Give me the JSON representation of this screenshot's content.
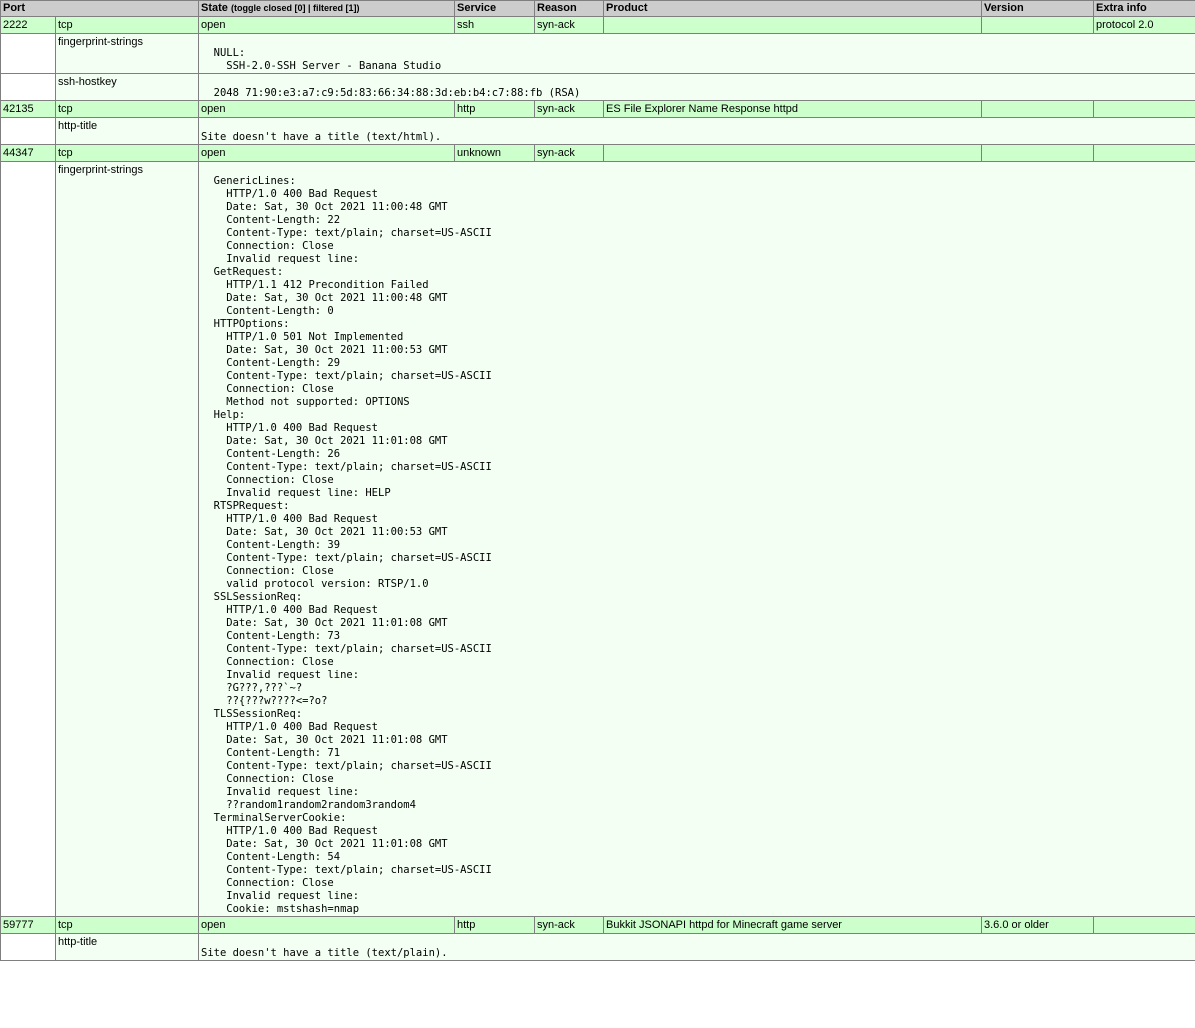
{
  "header": {
    "port": "Port",
    "state": "State",
    "state_hint_open": "(",
    "toggle_closed": "toggle closed [0]",
    "hint_sep": " | ",
    "filtered": "filtered [1]",
    "state_hint_close": ")",
    "service": "Service",
    "reason": "Reason",
    "product": "Product",
    "version": "Version",
    "extra_info": "Extra info"
  },
  "ports": [
    {
      "port": "2222",
      "protocol": "tcp",
      "state": "open",
      "service": "ssh",
      "reason": "syn-ack",
      "product": "",
      "version": "",
      "extra": "protocol 2.0",
      "scripts": [
        {
          "name": "fingerprint-strings",
          "output": "\n  NULL: \n    SSH-2.0-SSH Server - Banana Studio\n"
        },
        {
          "name": "ssh-hostkey",
          "output": "\n  2048 71:90:e3:a7:c9:5d:83:66:34:88:3d:eb:b4:c7:88:fb (RSA)\n"
        }
      ]
    },
    {
      "port": "42135",
      "protocol": "tcp",
      "state": "open",
      "service": "http",
      "reason": "syn-ack",
      "product": "ES File Explorer Name Response httpd",
      "version": "",
      "extra": "",
      "scripts": [
        {
          "name": "http-title",
          "output": "\nSite doesn't have a title (text/html).\n"
        }
      ]
    },
    {
      "port": "44347",
      "protocol": "tcp",
      "state": "open",
      "service": "unknown",
      "reason": "syn-ack",
      "product": "",
      "version": "",
      "extra": "",
      "scripts": [
        {
          "name": "fingerprint-strings",
          "output": "\n  GenericLines: \n    HTTP/1.0 400 Bad Request\n    Date: Sat, 30 Oct 2021 11:00:48 GMT\n    Content-Length: 22\n    Content-Type: text/plain; charset=US-ASCII\n    Connection: Close\n    Invalid request line:\n  GetRequest: \n    HTTP/1.1 412 Precondition Failed\n    Date: Sat, 30 Oct 2021 11:00:48 GMT\n    Content-Length: 0\n  HTTPOptions: \n    HTTP/1.0 501 Not Implemented\n    Date: Sat, 30 Oct 2021 11:00:53 GMT\n    Content-Length: 29\n    Content-Type: text/plain; charset=US-ASCII\n    Connection: Close\n    Method not supported: OPTIONS\n  Help: \n    HTTP/1.0 400 Bad Request\n    Date: Sat, 30 Oct 2021 11:01:08 GMT\n    Content-Length: 26\n    Content-Type: text/plain; charset=US-ASCII\n    Connection: Close\n    Invalid request line: HELP\n  RTSPRequest: \n    HTTP/1.0 400 Bad Request\n    Date: Sat, 30 Oct 2021 11:00:53 GMT\n    Content-Length: 39\n    Content-Type: text/plain; charset=US-ASCII\n    Connection: Close\n    valid protocol version: RTSP/1.0\n  SSLSessionReq: \n    HTTP/1.0 400 Bad Request\n    Date: Sat, 30 Oct 2021 11:01:08 GMT\n    Content-Length: 73\n    Content-Type: text/plain; charset=US-ASCII\n    Connection: Close\n    Invalid request line:\n    ?G???,???`~?\n    ??{???w????<=?o?\n  TLSSessionReq: \n    HTTP/1.0 400 Bad Request\n    Date: Sat, 30 Oct 2021 11:01:08 GMT\n    Content-Length: 71\n    Content-Type: text/plain; charset=US-ASCII\n    Connection: Close\n    Invalid request line:\n    ??random1random2random3random4\n  TerminalServerCookie: \n    HTTP/1.0 400 Bad Request\n    Date: Sat, 30 Oct 2021 11:01:08 GMT\n    Content-Length: 54\n    Content-Type: text/plain; charset=US-ASCII\n    Connection: Close\n    Invalid request line:\n    Cookie: mstshash=nmap\n"
        }
      ]
    },
    {
      "port": "59777",
      "protocol": "tcp",
      "state": "open",
      "service": "http",
      "reason": "syn-ack",
      "product": "Bukkit JSONAPI httpd for Minecraft game server",
      "version": "3.6.0 or older",
      "extra": "",
      "scripts": [
        {
          "name": "http-title",
          "output": "\nSite doesn't have a title (text/plain).\n"
        }
      ]
    }
  ]
}
